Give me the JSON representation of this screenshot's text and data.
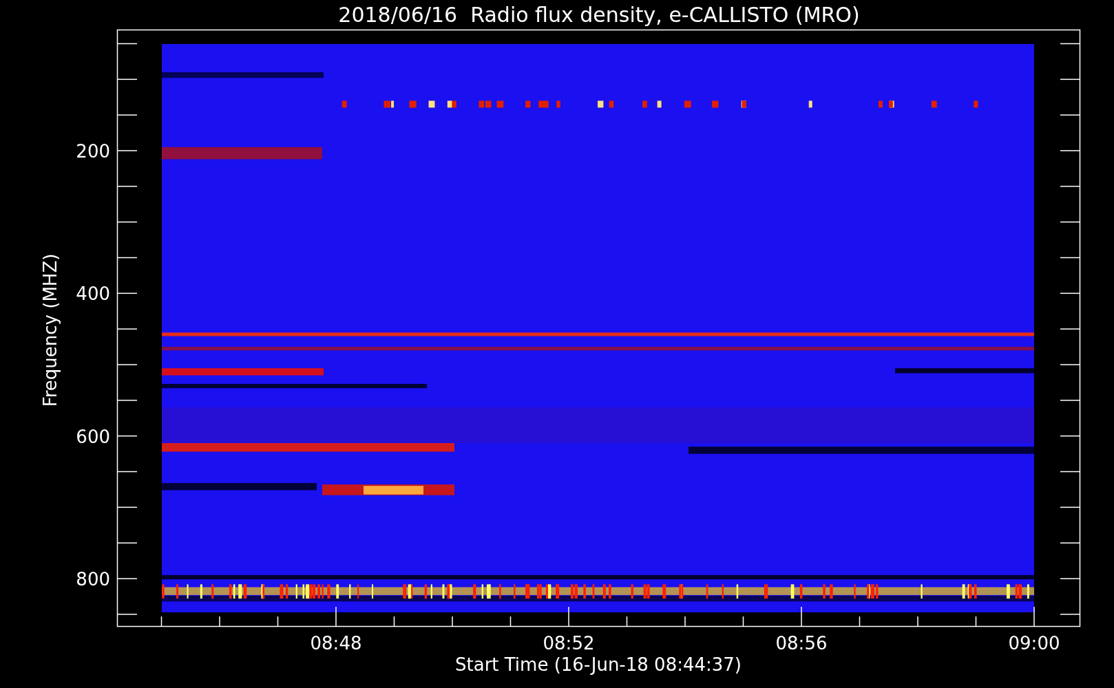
{
  "title": "2018/06/16  Radio flux density, e-CALLISTO (MRO)",
  "y_axis": {
    "label": "Frequency (MHZ)",
    "ticks": [
      "200",
      "400",
      "600",
      "800"
    ]
  },
  "x_axis": {
    "label": "Start Time (16-Jun-18 08:44:37)",
    "ticks": [
      "08:48",
      "08:52",
      "08:56",
      "09:00"
    ]
  }
}
